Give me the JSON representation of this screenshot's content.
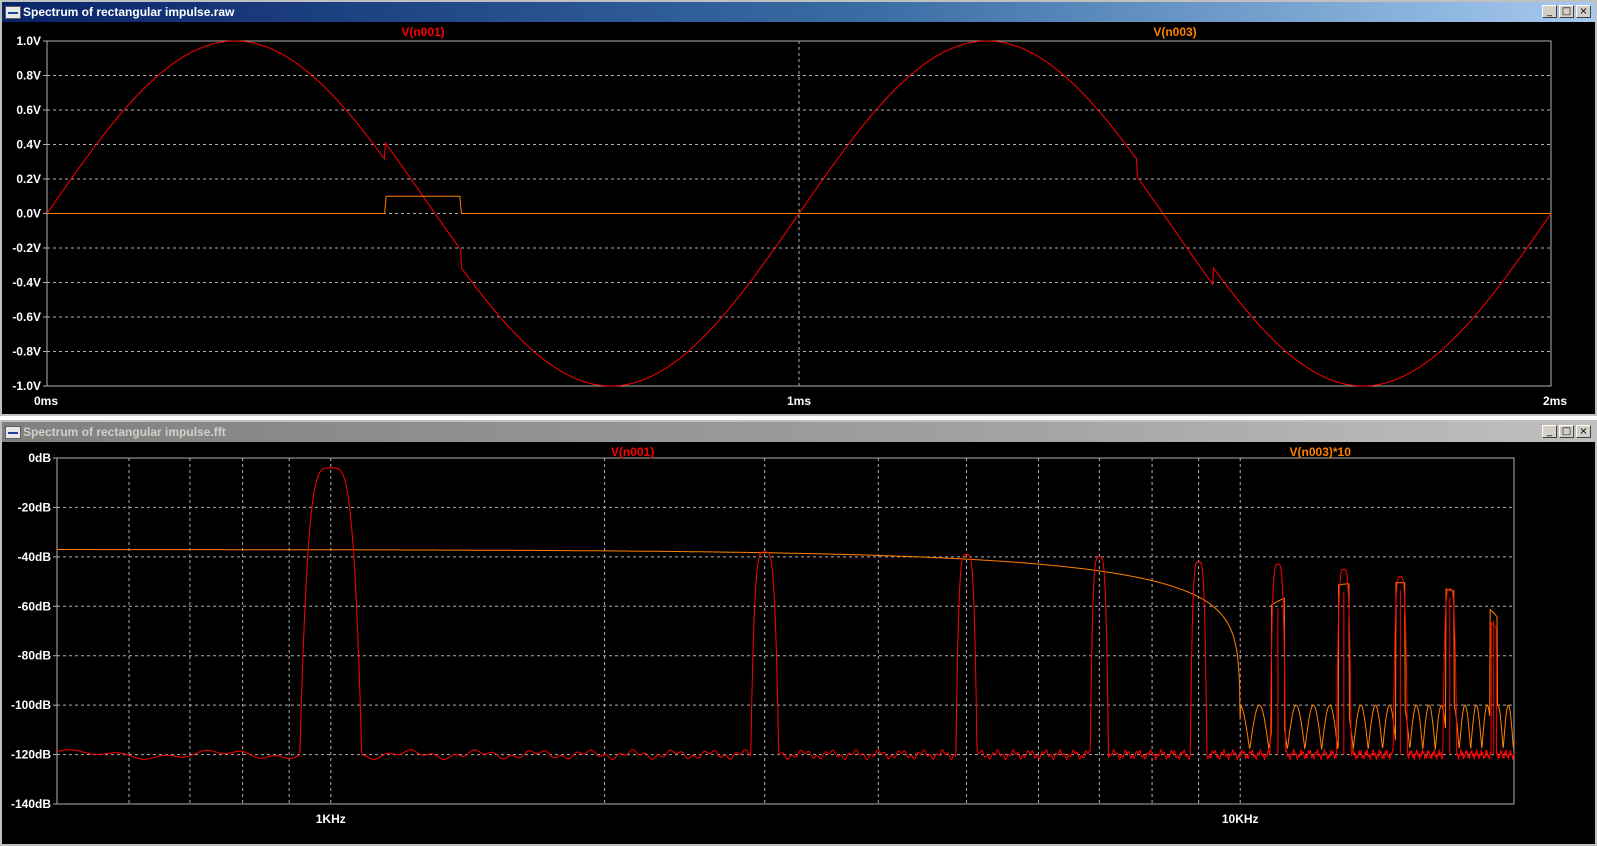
{
  "windows": [
    {
      "title": "Spectrum of rectangular impulse.raw",
      "active": true,
      "buttons": [
        "_",
        "□",
        "×"
      ]
    },
    {
      "title": "Spectrum of rectangular impulse.fft",
      "active": false,
      "buttons": [
        "_",
        "□",
        "×"
      ]
    }
  ],
  "colors": {
    "red_trace": "#ff0000",
    "orange_trace": "#ff8000",
    "grid": "#b0b0b0",
    "axis_text": "#ffffff",
    "background": "#000000"
  },
  "icons": [
    "waveform-window-icon",
    "minimize-icon",
    "maximize-icon",
    "close-icon"
  ],
  "chart_data": [
    {
      "type": "line",
      "series": [
        {
          "name": "V(n001)",
          "color": "#ff0000",
          "description_values": "sine 1 kHz amplitude 1 V plus rectangular pulse 0.1 V from 0.45 ms to 0.55 ms",
          "x": [
            0,
            0.05,
            0.1,
            0.15,
            0.2,
            0.25,
            0.3,
            0.35,
            0.4,
            0.449,
            0.45,
            0.5,
            0.549,
            0.55,
            0.6,
            0.65,
            0.7,
            0.75,
            0.8,
            0.85,
            0.9,
            0.95,
            1.0,
            1.05,
            1.1,
            1.15,
            1.2,
            1.25,
            1.3,
            1.35,
            1.4,
            1.449,
            1.45,
            1.5,
            1.549,
            1.55,
            1.6,
            1.65,
            1.7,
            1.75,
            1.8,
            1.85,
            1.9,
            1.95,
            2.0
          ],
          "y": [
            0,
            0.31,
            0.59,
            0.81,
            0.95,
            1.0,
            0.95,
            0.81,
            0.59,
            0.31,
            0.41,
            0.1,
            -0.21,
            -0.31,
            -0.59,
            -0.81,
            -0.95,
            -1.0,
            -0.95,
            -0.81,
            -0.59,
            -0.31,
            0,
            0.31,
            0.59,
            0.81,
            0.95,
            1.0,
            0.95,
            0.81,
            0.59,
            0.31,
            0.41,
            0.1,
            -0.21,
            -0.31,
            -0.59,
            -0.81,
            -0.95,
            -1.0,
            -0.95,
            -0.81,
            -0.59,
            -0.31,
            0
          ]
        },
        {
          "name": "V(n003)",
          "color": "#ff8000",
          "x": [
            0,
            0.449,
            0.451,
            0.549,
            0.551,
            2.0
          ],
          "y": [
            0,
            0,
            0.1,
            0.1,
            0,
            0
          ]
        }
      ],
      "x_unit": "ms",
      "xlim": [
        0,
        2
      ],
      "ylim": [
        -1.0,
        1.0
      ],
      "x_ticks": [
        "0ms",
        "1ms",
        "2ms"
      ],
      "y_ticks": [
        "1.0V",
        "0.8V",
        "0.6V",
        "0.4V",
        "0.2V",
        "0.0V",
        "-0.2V",
        "-0.4V",
        "-0.6V",
        "-0.8V",
        "-1.0V"
      ],
      "grid": true
    },
    {
      "type": "line",
      "x_scale": "log",
      "x_unit": "Hz",
      "xlim": [
        500,
        20000
      ],
      "ylim": [
        -140,
        0
      ],
      "x_ticks": [
        "1KHz",
        "10KHz"
      ],
      "y_ticks": [
        "0dB",
        "-20dB",
        "-40dB",
        "-60dB",
        "-80dB",
        "-100dB",
        "-120dB",
        "-140dB"
      ],
      "grid": true,
      "series": [
        {
          "name": "V(n001)",
          "color": "#ff0000",
          "noise_floor_db": -120,
          "peaks": [
            {
              "freq_hz": 1000,
              "db": -4
            },
            {
              "freq_hz": 3000,
              "db": -38
            },
            {
              "freq_hz": 5000,
              "db": -39
            },
            {
              "freq_hz": 7000,
              "db": -40
            },
            {
              "freq_hz": 9000,
              "db": -42
            },
            {
              "freq_hz": 11000,
              "db": -43
            },
            {
              "freq_hz": 13000,
              "db": -45
            },
            {
              "freq_hz": 15000,
              "db": -48
            },
            {
              "freq_hz": 17000,
              "db": -53
            }
          ]
        },
        {
          "name": "V(n003)*10",
          "color": "#ff8000",
          "envelope": {
            "type": "sinc",
            "width_ms": 0.1,
            "start_db": -37,
            "first_null_hz": 10000
          }
        }
      ]
    }
  ]
}
